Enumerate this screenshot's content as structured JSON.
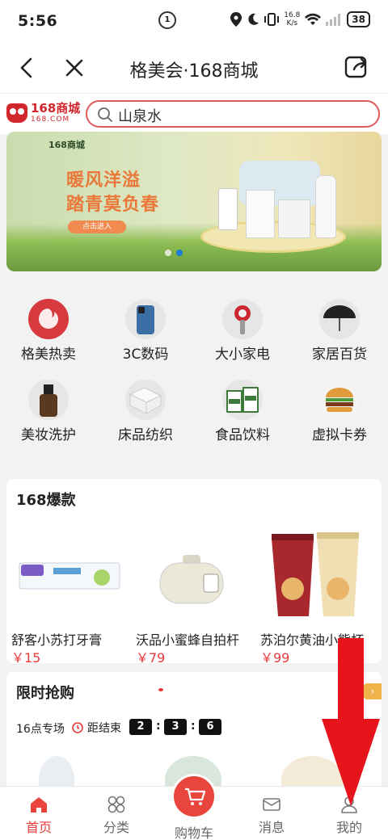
{
  "status_bar": {
    "time": "5:56",
    "notif_badge": "1",
    "net_speed_value": "16.8",
    "net_speed_unit": "K/s",
    "battery": "38"
  },
  "nav": {
    "title": "格美会·168商城",
    "back_icon": "chevron-left-icon",
    "close_icon": "close-icon",
    "share_icon": "share-out-icon"
  },
  "header": {
    "logo_text": "168商城",
    "logo_sub": "168.COM",
    "search_value": "山泉水"
  },
  "banner": {
    "logo": "168商城",
    "line1": "暖风洋溢",
    "line2": "踏青莫负春",
    "button": "点击进入",
    "page_count": 2,
    "active_page": 2
  },
  "categories": [
    {
      "label": "格美热卖",
      "icon": "gemei-logo-icon"
    },
    {
      "label": "3C数码",
      "icon": "phone-icon"
    },
    {
      "label": "大小家电",
      "icon": "hair-dryer-icon"
    },
    {
      "label": "家居百货",
      "icon": "umbrella-icon"
    },
    {
      "label": "美妆洗护",
      "icon": "serum-bottle-icon"
    },
    {
      "label": "床品纺织",
      "icon": "pillow-icon"
    },
    {
      "label": "食品饮料",
      "icon": "gift-box-icon"
    },
    {
      "label": "虚拟卡券",
      "icon": "burger-icon"
    }
  ],
  "hot": {
    "title": "168爆款",
    "items": [
      {
        "name": "舒客小苏打牙膏",
        "price": "￥15"
      },
      {
        "name": "沃品小蜜蜂自拍杆",
        "price": "￥79"
      },
      {
        "name": "苏泊尔黄油小熊杯",
        "price": "￥99"
      }
    ]
  },
  "flash": {
    "title": "限时抢购",
    "session": "16点专场",
    "ends_label": "距结束",
    "hours": "2",
    "minutes": "3",
    "seconds": "6",
    "colon": ":",
    "more_arrow": "›"
  },
  "tabbar": [
    {
      "label": "首页",
      "icon": "home-icon",
      "active": true
    },
    {
      "label": "分类",
      "icon": "category-grid-icon",
      "active": false
    },
    {
      "label": "购物车",
      "icon": "cart-icon",
      "active": false
    },
    {
      "label": "消息",
      "icon": "message-icon",
      "active": false
    },
    {
      "label": "我的",
      "icon": "user-icon",
      "active": false
    }
  ],
  "colors": {
    "brand_red": "#d0262c",
    "price_red": "#e83a3a",
    "annotation_arrow": "#e8141b"
  }
}
